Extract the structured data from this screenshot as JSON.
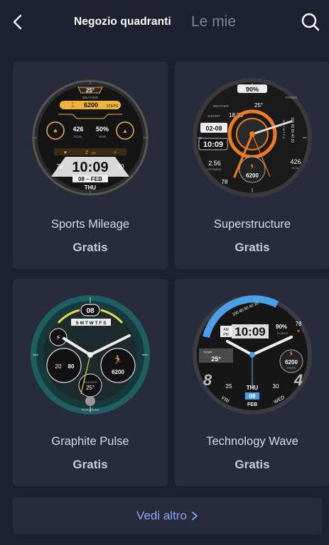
{
  "header": {
    "tab_store": "Negozio quadranti",
    "tab_mine": "Le mie"
  },
  "cards": [
    {
      "name": "Sports Mileage",
      "price": "Gratis",
      "face": {
        "temp": "25°",
        "weather": "WEATHER",
        "steps": "6200",
        "steps_label": "STEPS",
        "kcal": "426",
        "kcal_label": "KCAL",
        "hum": "50%",
        "hum_label": "HUM",
        "uv": "2",
        "uv_label": "UV",
        "left_num": "78",
        "right_num": "90",
        "time": "10:09",
        "date": "08 – FEB",
        "day": "THU"
      }
    },
    {
      "name": "Superstructure",
      "price": "Gratis",
      "face": {
        "battery": "90%",
        "power": "POWER",
        "weather": "WEATHER",
        "temp": "25°",
        "sunset_label": "SUNSET",
        "sunset": "18:30",
        "date": "02-08",
        "time": "10:09",
        "distance": "2.56",
        "distance_label": "DISTANCE",
        "steps": "6200",
        "kcal": "426",
        "kcal_label": "KCAL",
        "heart": "78",
        "weekdays": "S M T W T F S",
        "scale": "100 80 60 40 20"
      }
    },
    {
      "name": "Graphite Pulse",
      "price": "Gratis",
      "face": {
        "date_num": "08",
        "weekdays": "S M T W T F S",
        "left_val": "80",
        "left_sub": "20",
        "steps": "6200",
        "temp": "25°",
        "weather": "WEATHER",
        "moon": "Moon Phase"
      }
    },
    {
      "name": "Technology Wave",
      "price": "Gratis",
      "face": {
        "time": "10:09",
        "am": "AM",
        "pm": "PM",
        "battery": "90%",
        "power": "POWER",
        "heart": "78",
        "temp_label": "TEMP",
        "temp": "25°",
        "steps": "6200",
        "steps_label": "STEPS",
        "big_left": "8",
        "big_right": "4",
        "date": "08",
        "month": "FEB",
        "day": "THU",
        "fri": "FRI",
        "wed": "WED",
        "n25": "25",
        "n30": "30",
        "scale": "100 80 60 40 20"
      }
    }
  ],
  "more": {
    "label": "Vedi altro"
  },
  "colors": {
    "bg": "#1c2030",
    "card": "#272c3c",
    "link": "#8ea4f5",
    "orange": "#f07a20",
    "gold": "#f0b43c",
    "teal": "#1f5f62",
    "blue": "#4aa0e8"
  },
  "icons": [
    "back-chevron-icon",
    "search-icon",
    "chevron-right-icon"
  ]
}
